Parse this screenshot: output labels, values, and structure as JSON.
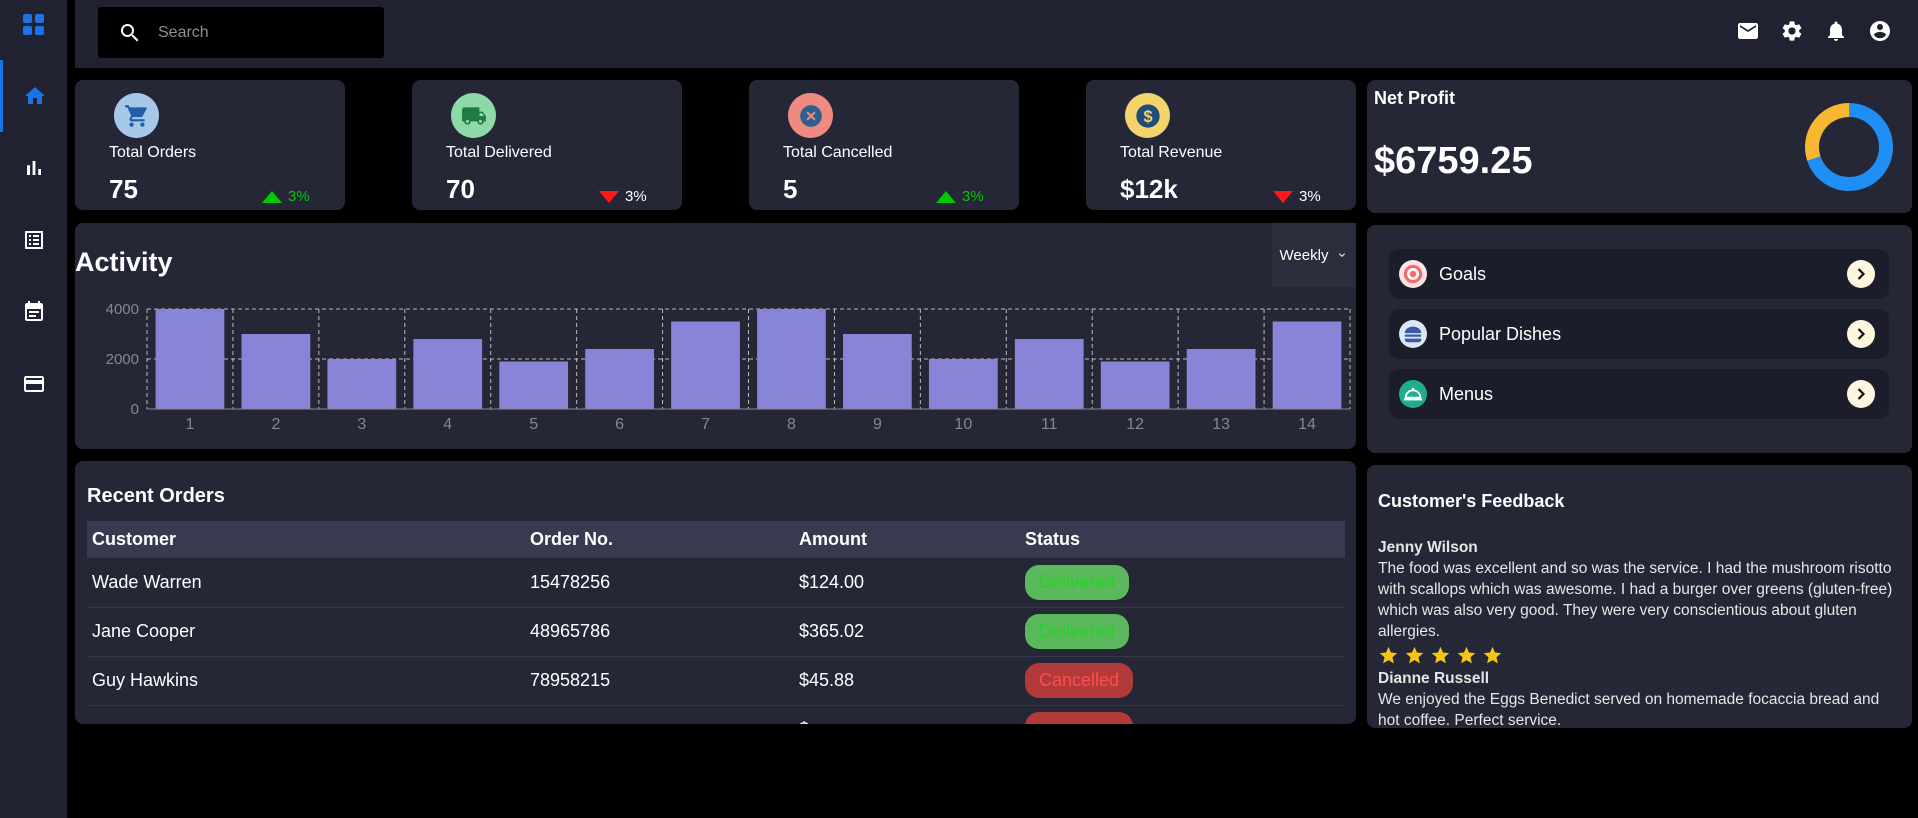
{
  "app": {
    "accent": "#1a73e8"
  },
  "search": {
    "placeholder": "Search"
  },
  "sidebar": {
    "items": [
      "home-icon",
      "chart-icon",
      "orders-list-icon",
      "calendar-icon",
      "payment-card-icon"
    ]
  },
  "stats": [
    {
      "label": "Total Orders",
      "value": "75",
      "trend": "up",
      "pct": "3%",
      "icon": "cart-icon",
      "color": "#a8c8ea"
    },
    {
      "label": "Total Delivered",
      "value": "70",
      "trend": "down",
      "pct": "3%",
      "icon": "truck-icon",
      "color": "#8fd9a8"
    },
    {
      "label": "Total Cancelled",
      "value": "5",
      "trend": "up",
      "pct": "3%",
      "icon": "cancel-icon",
      "color": "#f08a80"
    },
    {
      "label": "Total Revenue",
      "value": "$12k",
      "trend": "down",
      "pct": "3%",
      "icon": "dollar-icon",
      "color": "#f5d36b"
    }
  ],
  "net_profit": {
    "title": "Net Profit",
    "value": "$6759.25",
    "donut": {
      "blue": 0.7,
      "yellow": 0.3
    }
  },
  "activity": {
    "title": "Activity",
    "period": "Weekly"
  },
  "chart_data": {
    "type": "bar",
    "categories": [
      "1",
      "2",
      "3",
      "4",
      "5",
      "6",
      "7",
      "8",
      "9",
      "10",
      "11",
      "12",
      "13",
      "14"
    ],
    "values": [
      4000,
      3000,
      2000,
      2800,
      1900,
      2400,
      3500,
      4000,
      3000,
      2000,
      2800,
      1900,
      2400,
      3500
    ],
    "ylim": [
      0,
      4000
    ],
    "yticks": [
      0,
      2000,
      4000
    ],
    "grid": true,
    "bar_color": "#8884d8"
  },
  "links": [
    {
      "label": "Goals",
      "icon": "target-icon"
    },
    {
      "label": "Popular Dishes",
      "icon": "burger-icon"
    },
    {
      "label": "Menus",
      "icon": "cloche-icon"
    }
  ],
  "recent_orders": {
    "title": "Recent Orders",
    "headers": [
      "Customer",
      "Order No.",
      "Amount",
      "Status"
    ],
    "rows": [
      {
        "customer": "Wade Warren",
        "order": "15478256",
        "amount": "$124.00",
        "status": "Delivered"
      },
      {
        "customer": "Jane Cooper",
        "order": "48965786",
        "amount": "$365.02",
        "status": "Delivered"
      },
      {
        "customer": "Guy Hawkins",
        "order": "78958215",
        "amount": "$45.88",
        "status": "Cancelled"
      }
    ]
  },
  "feedback": {
    "title": "Customer's Feedback",
    "items": [
      {
        "name": "Jenny Wilson",
        "text": "The food was excellent and so was the service. I had the mushroom risotto with scallops which was awesome. I had a burger over greens (gluten-free) which was also very good. They were very conscientious about gluten allergies.",
        "stars": 5
      },
      {
        "name": "Dianne Russell",
        "text": "We enjoyed the Eggs Benedict served on homemade focaccia bread and hot coffee. Perfect service.",
        "stars": 0
      }
    ]
  }
}
